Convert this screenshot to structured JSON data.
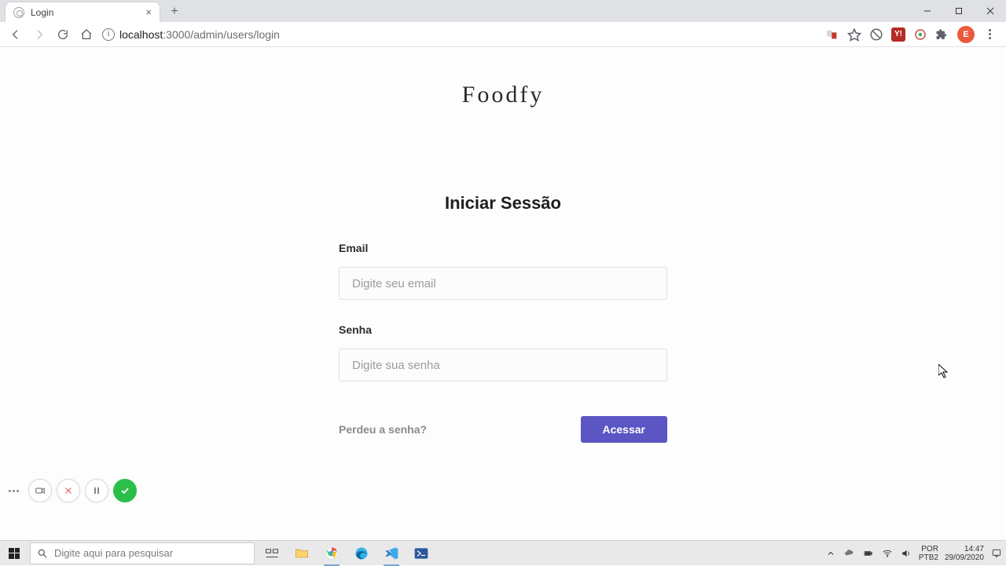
{
  "browser": {
    "tab_title": "Login",
    "url_host": "localhost",
    "url_port_path": ":3000/admin/users/login",
    "avatar_letter": "E",
    "ext_box_label": "Y!"
  },
  "page": {
    "logo": "Foodfy",
    "form_title": "Iniciar Sessão",
    "email": {
      "label": "Email",
      "placeholder": "Digite seu email",
      "value": ""
    },
    "password": {
      "label": "Senha",
      "placeholder": "Digite sua senha",
      "value": ""
    },
    "forgot_label": "Perdeu a senha?",
    "submit_label": "Acessar"
  },
  "taskbar": {
    "search_placeholder": "Digite aqui para pesquisar",
    "lang1": "POR",
    "lang2": "PTB2",
    "time": "14:47",
    "date": "29/09/2020"
  }
}
